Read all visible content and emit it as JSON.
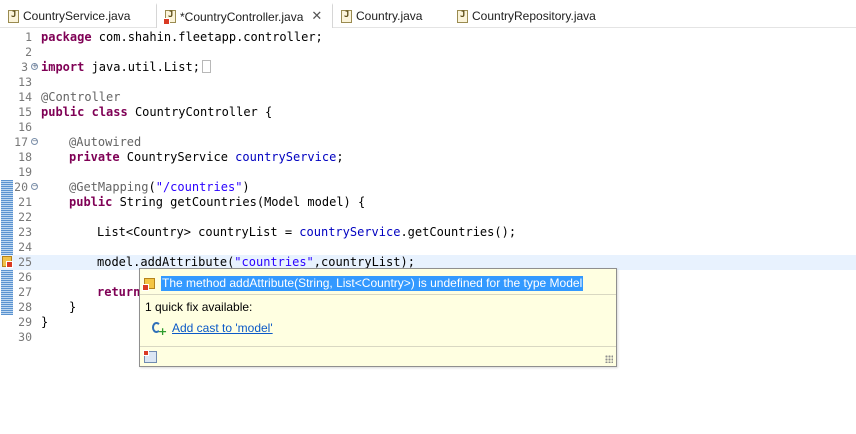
{
  "tabs": [
    {
      "label": "CountryService.java",
      "active": false,
      "dirty": false,
      "error": false
    },
    {
      "label": "*CountryController.java",
      "active": true,
      "dirty": true,
      "error": true,
      "close": "✕"
    },
    {
      "label": "Country.java",
      "active": false,
      "dirty": false,
      "error": false
    },
    {
      "label": "CountryRepository.java",
      "active": false,
      "dirty": false,
      "error": false
    }
  ],
  "code": {
    "lines": [
      {
        "n": "1",
        "text": "package com.shahin.fleetapp.controller;"
      },
      {
        "n": "2",
        "text": ""
      },
      {
        "n": "3",
        "text": "import java.util.List;"
      },
      {
        "n": "13",
        "text": ""
      },
      {
        "n": "14",
        "text": "@Controller"
      },
      {
        "n": "15",
        "text": "public class CountryController {"
      },
      {
        "n": "16",
        "text": ""
      },
      {
        "n": "17",
        "text": "@Autowired"
      },
      {
        "n": "18",
        "text": "private CountryService countryService;"
      },
      {
        "n": "19",
        "text": ""
      },
      {
        "n": "20",
        "text": "@GetMapping(\"/countries\")"
      },
      {
        "n": "21",
        "text": "public String getCountries(Model model) {"
      },
      {
        "n": "22",
        "text": ""
      },
      {
        "n": "23",
        "text": "List<Country> countryList = countryService.getCountries();"
      },
      {
        "n": "24",
        "text": ""
      },
      {
        "n": "25",
        "text": "model.addAttribute(\"countries\",countryList);"
      },
      {
        "n": "26",
        "text": ""
      },
      {
        "n": "27",
        "text": "return"
      },
      {
        "n": "28",
        "text": "}"
      },
      {
        "n": "29",
        "text": "}"
      },
      {
        "n": "30",
        "text": ""
      }
    ]
  },
  "hover": {
    "message": "The method addAttribute(String, List<Country>) is undefined for the type Model",
    "quick_fix_title": "1 quick fix available:",
    "quick_fix_label": "Add cast to 'model'"
  },
  "colors": {
    "keyword": "#7f0055",
    "annotation": "#646464",
    "string": "#2a00ff",
    "field": "#0000c0",
    "error": "#d93a24",
    "hover_bg": "#ffffe1",
    "selection": "#3399ff",
    "link": "#0b59c7"
  },
  "icons": {
    "tab": "java-file-icon",
    "tab_error": "java-file-error-icon",
    "gutter_error": "error-quickfix-icon",
    "quick_fix": "quick-fix-cast-icon",
    "footer": "configure-hover-icon"
  }
}
